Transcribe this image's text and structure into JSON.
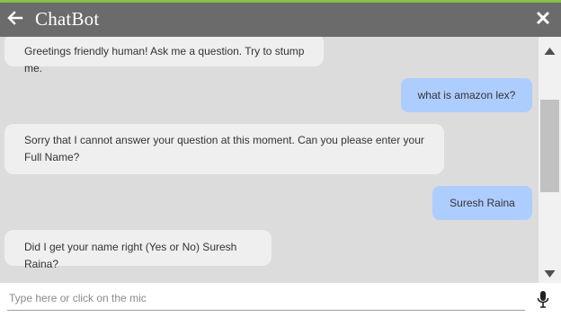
{
  "header": {
    "title": "ChatBot",
    "back_icon": "back-arrow-icon",
    "close_icon": "close-icon",
    "background": "#6b6b6b",
    "accent": "#8bc34a"
  },
  "messages": [
    {
      "sender": "bot",
      "text": "Greetings friendly human! Ask me a question. Try to stump me."
    },
    {
      "sender": "user",
      "text": "what is amazon lex?"
    },
    {
      "sender": "bot",
      "text": "Sorry that I cannot answer your question at this moment. Can you please enter your Full Name?"
    },
    {
      "sender": "user",
      "text": "Suresh Raina"
    },
    {
      "sender": "bot",
      "text": "Did I get your name right (Yes or No) Suresh Raina?"
    }
  ],
  "colors": {
    "bot_bubble": "#efefef",
    "user_bubble": "#aecdff",
    "chat_background": "#dcdcdc"
  },
  "footer": {
    "input_placeholder": "Type here or click on the mic",
    "input_value": "",
    "mic_icon": "microphone-icon"
  }
}
